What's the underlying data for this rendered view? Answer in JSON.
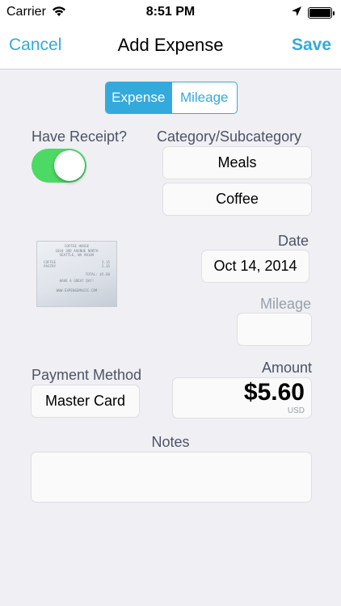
{
  "status_bar": {
    "carrier": "Carrier",
    "time": "8:51 PM",
    "icons": [
      "wifi-icon",
      "location-arrow-icon",
      "battery-icon"
    ]
  },
  "nav": {
    "cancel": "Cancel",
    "title": "Add Expense",
    "save": "Save"
  },
  "segment": {
    "options": [
      "Expense",
      "Mileage"
    ],
    "selected": "Expense"
  },
  "receipt": {
    "label": "Have Receipt?",
    "has_receipt": true,
    "thumbnail": {
      "line1": "COFFEE HOUSE",
      "line2": "1034 3RD AVENUE NORTH",
      "line3": "SEATTLE, WA 98109",
      "items": [
        {
          "name": "COFFEE",
          "price": "3.15"
        },
        {
          "name": "PASTRY",
          "price": "2.35"
        }
      ],
      "total": "TOTAL: $5.60",
      "thanks": "HAVE A GREAT DAY!",
      "footer": "WWW.EXPENSEMAGIC.COM"
    }
  },
  "category": {
    "label": "Category/Subcategory",
    "category": "Meals",
    "subcategory": "Coffee"
  },
  "date": {
    "label": "Date",
    "value": "Oct 14, 2014"
  },
  "mileage": {
    "label": "Mileage",
    "value": ""
  },
  "payment": {
    "label": "Payment Method",
    "value": "Master Card"
  },
  "amount": {
    "label": "Amount",
    "value": "$5.60",
    "currency": "USD"
  },
  "notes": {
    "label": "Notes",
    "value": ""
  },
  "colors": {
    "accent": "#34aadc",
    "toggle_on": "#4cd964",
    "label": "#4d5366",
    "muted": "#9aa0aa",
    "background": "#efeff4"
  }
}
